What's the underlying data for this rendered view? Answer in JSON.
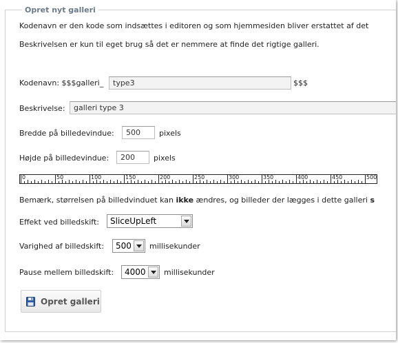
{
  "legend": "Opret nyt galleri",
  "intro_line1": "Kodenavn er den kode som indsættes i editoren og som hjemmesiden bliver erstattet af det",
  "intro_line2": "Beskrivelsen er kun til eget brug så det er nemmere at finde det rigtige galleri.",
  "kodenavn": {
    "label_prefix": "Kodenavn: $$$galleri_",
    "value": "type3",
    "suffix": "$$$"
  },
  "beskrivelse": {
    "label": "Beskrivelse:",
    "value": "galleri type 3"
  },
  "bredde": {
    "label": "Bredde på billedevindue:",
    "value": "500",
    "unit": "pixels"
  },
  "hojde": {
    "label": "Højde på billedevindue:",
    "value": "200",
    "unit": "pixels"
  },
  "ruler": {
    "labels": [
      "0",
      "50",
      "100",
      "150",
      "200",
      "250",
      "300",
      "350",
      "400",
      "450",
      "500"
    ]
  },
  "note": {
    "before": "Bemærk, størrelsen på billedvinduet kan ",
    "bold": "ikke",
    "after": " ændres, og billeder der lægges i dette galleri ",
    "tail": "s"
  },
  "effekt": {
    "label": "Effekt ved billedskift:",
    "selected": "SliceUpLeft"
  },
  "varighed": {
    "label": "Varighed af billedskift:",
    "selected": "500",
    "unit": "millisekunder"
  },
  "pause": {
    "label": "Pause mellem billedskift:",
    "selected": "4000",
    "unit": "millisekunder"
  },
  "submit": {
    "label": "Opret galleri",
    "icon": "floppy-disk-icon"
  }
}
